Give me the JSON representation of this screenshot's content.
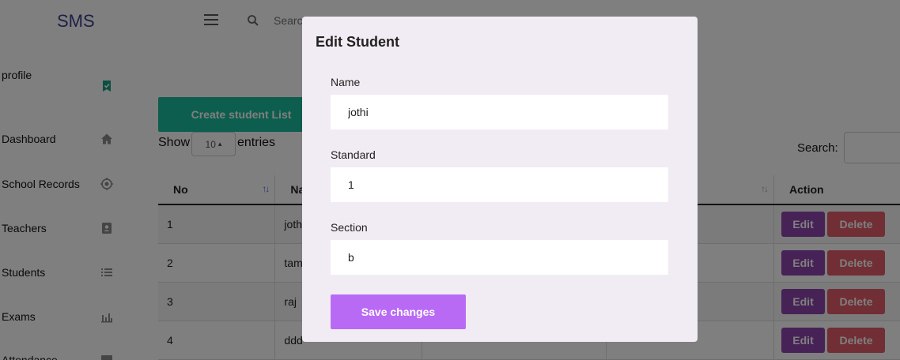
{
  "app": {
    "brand": "SMS"
  },
  "sidebar": {
    "items": [
      {
        "label": "profile",
        "icon": "bookmark-icon"
      },
      {
        "label": "Dashboard",
        "icon": "home-icon"
      },
      {
        "label": "School Records",
        "icon": "target-icon"
      },
      {
        "label": "Teachers",
        "icon": "contact-card-icon"
      },
      {
        "label": "Students",
        "icon": "list-icon"
      },
      {
        "label": "Exams",
        "icon": "bar-chart-icon"
      },
      {
        "label": "Attendance",
        "icon": "calendar-icon"
      }
    ]
  },
  "topbar": {
    "search_placeholder": "Search..."
  },
  "main": {
    "create_button": "Create student List",
    "show_label": "Show",
    "entries_value": "10",
    "entries_label": "entries",
    "search_label": "Search:",
    "table": {
      "headers": {
        "no": "No",
        "name": "Name",
        "action": "Action"
      },
      "rows": [
        {
          "no": "1",
          "name": "jothi"
        },
        {
          "no": "2",
          "name": "tamil"
        },
        {
          "no": "3",
          "name": "raj"
        },
        {
          "no": "4",
          "name": "ddd"
        }
      ],
      "edit_label": "Edit",
      "delete_label": "Delete"
    }
  },
  "modal": {
    "title": "Edit Student",
    "fields": [
      {
        "label": "Name",
        "value": "jothi"
      },
      {
        "label": "Standard",
        "value": "1"
      },
      {
        "label": "Section",
        "value": "b"
      }
    ],
    "save_label": "Save changes"
  },
  "colors": {
    "accent_teal": "#1abc9c",
    "edit_purple": "#8e44ad",
    "delete_red": "#e35d6a",
    "save_violet": "#b96af5",
    "modal_bg": "#f1ecf3"
  }
}
